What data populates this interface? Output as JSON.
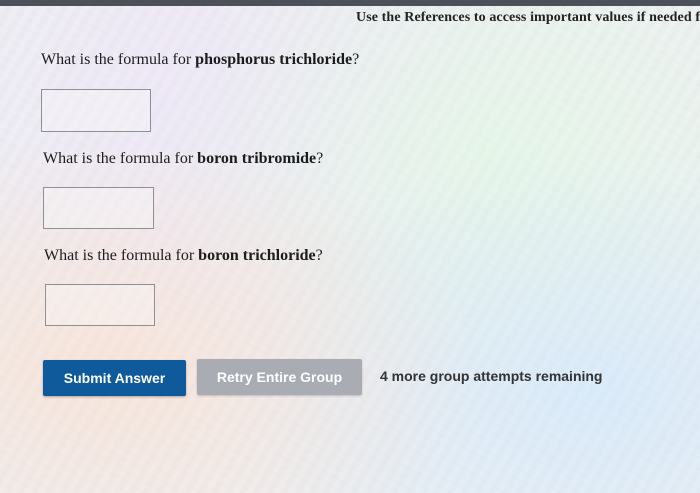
{
  "header": {
    "references_text": "Use the References to access important values if needed f"
  },
  "questions": [
    {
      "prefix": "What is the formula for ",
      "compound": "phosphorus trichloride",
      "suffix": "?",
      "answer_value": ""
    },
    {
      "prefix": "What is the formula for ",
      "compound": "boron tribromide",
      "suffix": "?",
      "answer_value": ""
    },
    {
      "prefix": "What is the formula for ",
      "compound": "boron trichloride",
      "suffix": "?",
      "answer_value": ""
    }
  ],
  "actions": {
    "submit_label": "Submit Answer",
    "retry_label": "Retry Entire Group",
    "attempts_text": "4 more group attempts remaining"
  },
  "colors": {
    "submit_bg": "#0e5a9a",
    "retry_bg": "#a9adb3",
    "top_bar": "#4c5058"
  }
}
